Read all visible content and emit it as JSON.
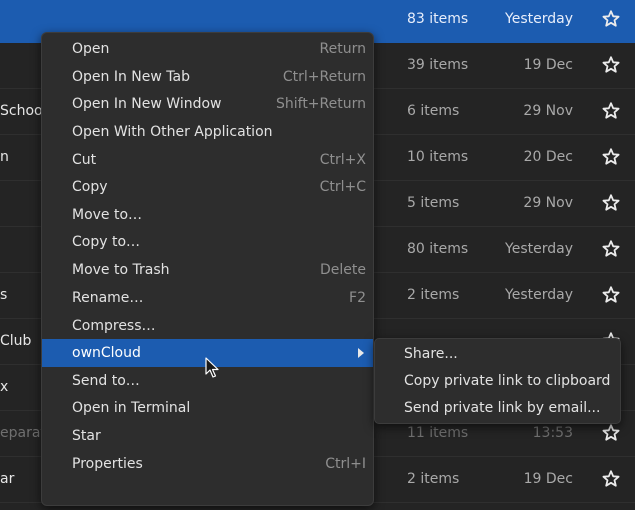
{
  "file_rows": [
    {
      "name": "",
      "size": "83 items",
      "date": "Yesterday",
      "selected": true
    },
    {
      "name": "",
      "size": "39 items",
      "date": "19 Dec"
    },
    {
      "name": " Schoo",
      "size": "6 items",
      "date": "29 Nov"
    },
    {
      "name": "n",
      "size": "10 items",
      "date": "20 Dec"
    },
    {
      "name": "",
      "size": "5 items",
      "date": "29 Nov"
    },
    {
      "name": "",
      "size": "80 items",
      "date": "Yesterday"
    },
    {
      "name": "s",
      "size": "2 items",
      "date": "Yesterday"
    },
    {
      "name": "Club",
      "size": "",
      "date": ""
    },
    {
      "name": "x",
      "size": "",
      "date": ""
    },
    {
      "name": "eparati",
      "size": "11 items",
      "date": "13:53",
      "dim": true
    },
    {
      "name": "ar",
      "size": "2 items",
      "date": "19 Dec"
    }
  ],
  "icons": {
    "star": "star-outline-icon",
    "arrow": "submenu-arrow-icon",
    "cursor": "mouse-pointer-icon"
  },
  "context_menu": {
    "items": [
      {
        "label": "Open",
        "accel": "Return"
      },
      {
        "label": "Open In New Tab",
        "accel": "Ctrl+Return"
      },
      {
        "label": "Open In New Window",
        "accel": "Shift+Return"
      },
      {
        "label": "Open With Other Application",
        "accel": ""
      },
      {
        "label": "Cut",
        "accel": "Ctrl+X"
      },
      {
        "label": "Copy",
        "accel": "Ctrl+C"
      },
      {
        "label": "Move to…",
        "accel": ""
      },
      {
        "label": "Copy to…",
        "accel": ""
      },
      {
        "label": "Move to Trash",
        "accel": "Delete"
      },
      {
        "label": "Rename…",
        "accel": "F2"
      },
      {
        "label": "Compress…",
        "accel": ""
      },
      {
        "label": "ownCloud",
        "accel": "",
        "submenu": true,
        "hover": true
      },
      {
        "label": "Send to…",
        "accel": ""
      },
      {
        "label": "Open in Terminal",
        "accel": ""
      },
      {
        "label": "Star",
        "accel": ""
      },
      {
        "label": "Properties",
        "accel": "Ctrl+I"
      }
    ]
  },
  "submenu": {
    "items": [
      {
        "label": "Share..."
      },
      {
        "label": "Copy private link to clipboard"
      },
      {
        "label": "Send private link by email..."
      }
    ]
  },
  "colors": {
    "accent": "#1c5cb0",
    "background": "#242424",
    "menu": "#2d2d2d"
  }
}
